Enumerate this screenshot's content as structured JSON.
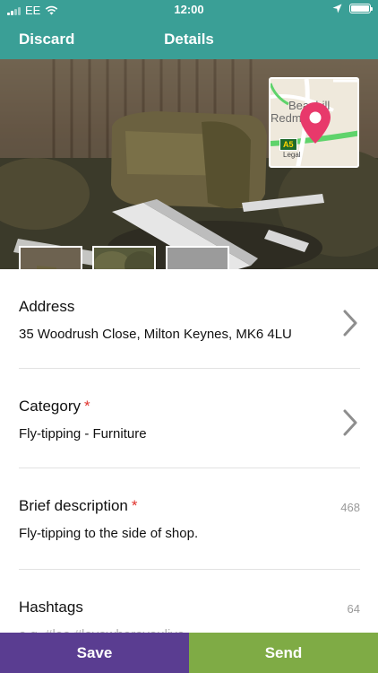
{
  "status": {
    "carrier": "EE",
    "time": "12:00"
  },
  "nav": {
    "discard_label": "Discard",
    "title": "Details"
  },
  "map": {
    "place_line1": "Beanhill",
    "place_line2": "Redmoor",
    "road": "A5",
    "legal": "Legal"
  },
  "photo": {
    "add_icon": "+"
  },
  "form": {
    "address": {
      "label": "Address",
      "value": "35 Woodrush Close, Milton Keynes, MK6 4LU"
    },
    "category": {
      "label": "Category",
      "required_mark": "*",
      "value": "Fly-tipping - Furniture"
    },
    "description": {
      "label": "Brief description",
      "required_mark": "*",
      "count": "468",
      "value": "Fly-tipping to the side of shop."
    },
    "hashtags": {
      "label": "Hashtags",
      "count": "64",
      "placeholder": "e.g. #loo #lovewhereyoulive"
    }
  },
  "actions": {
    "save_label": "Save",
    "send_label": "Send"
  },
  "colors": {
    "header": "#3a9f96",
    "save": "#5a3d91",
    "send": "#7fab45",
    "required": "#e0322c",
    "map_pin": "#e8396b"
  }
}
